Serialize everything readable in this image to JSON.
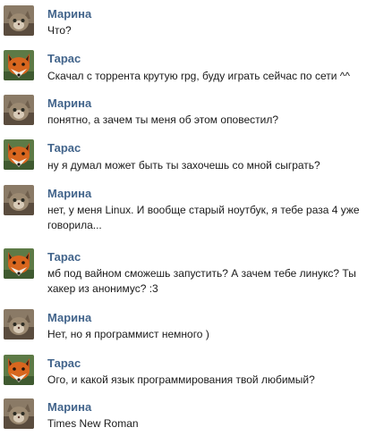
{
  "conversation": {
    "messages": [
      {
        "author": "Марина",
        "avatar": "cat-avatar-icon",
        "text": "Что?"
      },
      {
        "author": "Тарас",
        "avatar": "fox-avatar-icon",
        "text": "Скачал с торрента крутую rpg, буду играть сейчас по сети ^^"
      },
      {
        "author": "Марина",
        "avatar": "cat-avatar-icon",
        "text": "понятно, а зачем ты меня об этом оповестил?"
      },
      {
        "author": "Тарас",
        "avatar": "fox-avatar-icon",
        "text": "ну я думал может быть ты захочешь со мной сыграть?"
      },
      {
        "author": "Марина",
        "avatar": "cat-avatar-icon",
        "text": "нет, у меня Linux. И вообще старый ноутбук, я тебе раза 4 уже говорила..."
      },
      {
        "author": "Тарас",
        "avatar": "fox-avatar-icon",
        "text": "мб под вайном сможешь запустить? А зачем тебе линукс? Ты хакер из анонимус? :3"
      },
      {
        "author": "Марина",
        "avatar": "cat-avatar-icon",
        "text": "Нет, но я программист немного )"
      },
      {
        "author": "Тарас",
        "avatar": "fox-avatar-icon",
        "text": "Ого, и какой язык программирования твой любимый?"
      },
      {
        "author": "Марина",
        "avatar": "cat-avatar-icon",
        "text": "Times New Roman"
      }
    ]
  }
}
